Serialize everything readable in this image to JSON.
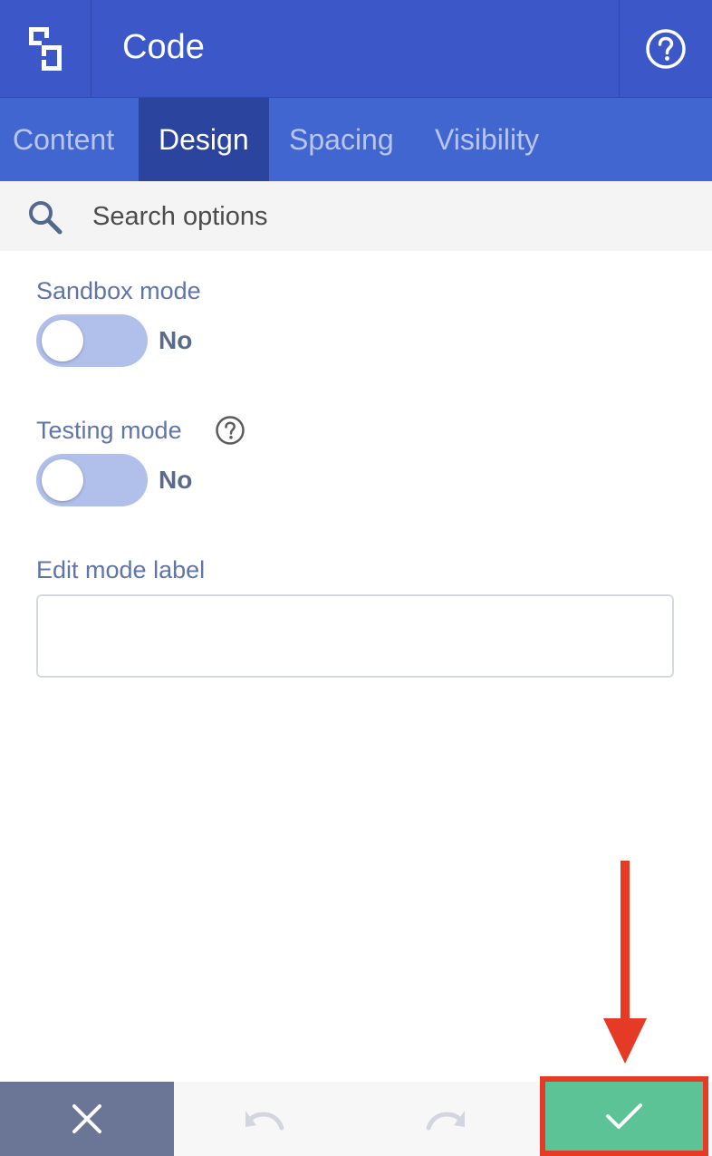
{
  "header": {
    "title": "Code",
    "logo_icon": "divi-logo-icon",
    "help_icon": "question-circle-icon"
  },
  "tabs": [
    {
      "label": "Content",
      "active": false
    },
    {
      "label": "Design",
      "active": true
    },
    {
      "label": "Spacing",
      "active": false
    },
    {
      "label": "Visibility",
      "active": false
    }
  ],
  "search": {
    "placeholder": "Search options",
    "value": ""
  },
  "fields": {
    "sandbox": {
      "label": "Sandbox mode",
      "state": "No"
    },
    "testing": {
      "label": "Testing mode",
      "state": "No"
    },
    "edit_label": {
      "label": "Edit mode label",
      "value": ""
    }
  },
  "footer": {
    "cancel_icon": "close-icon",
    "undo_icon": "undo-icon",
    "redo_icon": "redo-icon",
    "save_icon": "check-icon"
  },
  "colors": {
    "header": "#3c58c8",
    "tabs": "#4266d0",
    "active_tab": "#2b459e",
    "save": "#5cc396",
    "cancel": "#6b7697",
    "annotation": "#e53a26"
  }
}
